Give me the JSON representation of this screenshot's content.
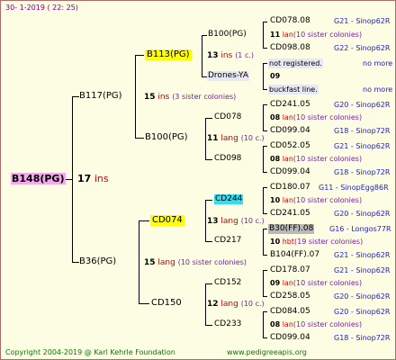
{
  "header": {
    "date": "30- 1-2019 ( 22: 25)"
  },
  "footer": {
    "copyright": "Copyright 2004-2019 @ Karl Kehrle Foundation",
    "website": "www.pedigreeapis.org"
  },
  "root": {
    "name": "B148(PG)",
    "ins": "17",
    "ins_label": "ins"
  },
  "gen1": {
    "upper": {
      "name": "B117(PG)",
      "ins": "15",
      "ins_label": "ins",
      "sisters": "(3 sister colonies)"
    },
    "lower": {
      "name": "B36(PG)",
      "ins": "15",
      "ins_label": "lang",
      "sisters": "(10 sister colonies)"
    }
  },
  "gen2": {
    "a": {
      "name": "B113(PG)",
      "ins": "13",
      "ins_label": "ins",
      "sisters": "(1 c.)"
    },
    "b": {
      "name": "B100(PG)",
      "ins": "11",
      "ins_label": "lang",
      "sisters": "(10 c.)"
    },
    "c": {
      "name": "CD074",
      "ins": "13",
      "ins_label": "lang",
      "sisters": "(10 c.)"
    },
    "d": {
      "name": "CD150",
      "ins": "12",
      "ins_label": "lang",
      "sisters": "(10 c.)"
    }
  },
  "gen3": {
    "a1": {
      "name": "B100(PG)",
      "ins": "11",
      "ins_label": "lan",
      "sisters": "(10 sister colonies)"
    },
    "a2": {
      "name": "Drones-YA",
      "ins": "09",
      "ins_label": "",
      "sisters": ""
    },
    "b1": {
      "name": "CD078",
      "ins": "08",
      "ins_label": "lan",
      "sisters": "(10 sister colonies)"
    },
    "b2": {
      "name": "CD098",
      "ins": "08",
      "ins_label": "lan",
      "sisters": "(10 sister colonies)"
    },
    "c1": {
      "name": "CD244",
      "ins": "10",
      "ins_label": "lan",
      "sisters": "(10 sister colonies)"
    },
    "c2": {
      "name": "CD217",
      "ins": "10",
      "ins_label": "hbt",
      "sisters": "(19 sister colonies)"
    },
    "d1": {
      "name": "CD152",
      "ins": "09",
      "ins_label": "lan",
      "sisters": "(10 sister colonies)"
    },
    "d2": {
      "name": "CD233",
      "ins": "08",
      "ins_label": "lan",
      "sisters": "(10 sister colonies)"
    }
  },
  "gen4": [
    {
      "name": "CD078.08",
      "group": "G21 - Sinop62R"
    },
    {
      "name": "CD098.08",
      "group": "G22 - Sinop62R"
    },
    {
      "name": "not registered.",
      "group": "no more"
    },
    {
      "name": "buckfast line.",
      "group": "no more"
    },
    {
      "name": "CD241.05",
      "group": "G20 - Sinop62R"
    },
    {
      "name": "CD099.04",
      "group": "G18 - Sinop72R"
    },
    {
      "name": "CD052.05",
      "group": "G21 - Sinop62R"
    },
    {
      "name": "CD099.04",
      "group": "G18 - Sinop72R"
    },
    {
      "name": "CD180.07",
      "group": "G11 - SinopEgg86R"
    },
    {
      "name": "CD241.05",
      "group": "G20 - Sinop62R"
    },
    {
      "name": "B30(FF).08",
      "group": "G16 - Longos77R"
    },
    {
      "name": "B104(FF).07",
      "group": "G21 - Sinop62R"
    },
    {
      "name": "CD178.07",
      "group": "G21 - Sinop62R"
    },
    {
      "name": "CD258.05",
      "group": "G20 - Sinop62R"
    },
    {
      "name": "CD084.05",
      "group": "G20 - Sinop62R"
    },
    {
      "name": "CD099.04",
      "group": "G18 - Sinop72R"
    }
  ],
  "colors": {
    "background": "#fdfde4",
    "highlight_yellow": "#ffff00",
    "highlight_cyan": "#33ddee",
    "highlight_pink": "#f5a8ec",
    "highlight_gray": "#b9b9b9",
    "ins_red": "#d00000",
    "sister_purple": "#7a1fa2",
    "group_blue": "#2020d0"
  }
}
